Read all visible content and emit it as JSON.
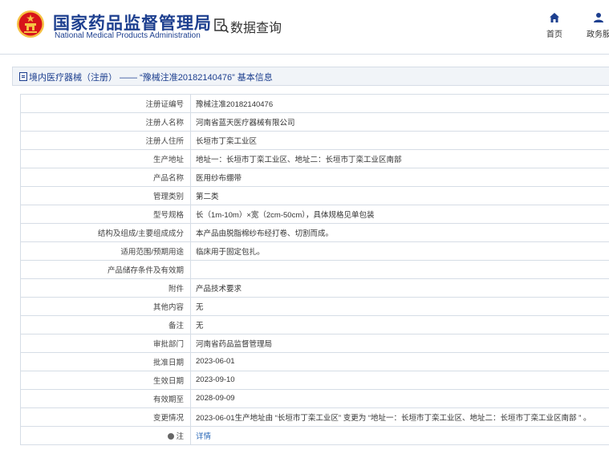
{
  "header": {
    "site_name_cn": "国家药品监督管理局",
    "site_name_en": "National Medical Products Administration",
    "page_title": "数据查询",
    "nav": [
      {
        "label": "首页",
        "icon": "home-icon"
      },
      {
        "label": "政务服",
        "icon": "user-icon"
      }
    ]
  },
  "breadcrumb": {
    "text": "境内医疗器械（注册） —— “豫械注准20182140476” 基本信息"
  },
  "record": [
    {
      "label": "注册证编号",
      "value": "豫械注准20182140476"
    },
    {
      "label": "注册人名称",
      "value": "河南省蓝天医疗器械有限公司"
    },
    {
      "label": "注册人住所",
      "value": "长垣市丁栾工业区"
    },
    {
      "label": "生产地址",
      "value": "地址一：长垣市丁栾工业区、地址二：长垣市丁栾工业区南部"
    },
    {
      "label": "产品名称",
      "value": "医用纱布绷带"
    },
    {
      "label": "管理类别",
      "value": "第二类"
    },
    {
      "label": "型号规格",
      "value": "长（1m-10m）×宽（2cm-50cm），具体规格见单包装"
    },
    {
      "label": "结构及组成/主要组成成分",
      "value": "本产品由脱脂棉纱布经打卷、切割而成。"
    },
    {
      "label": "适用范围/预期用途",
      "value": "临床用于固定包扎。"
    },
    {
      "label": "产品储存条件及有效期",
      "value": ""
    },
    {
      "label": "附件",
      "value": "产品技术要求"
    },
    {
      "label": "其他内容",
      "value": "无"
    },
    {
      "label": "备注",
      "value": "无"
    },
    {
      "label": "审批部门",
      "value": "河南省药品监督管理局"
    },
    {
      "label": "批准日期",
      "value": "2023-06-01"
    },
    {
      "label": "生效日期",
      "value": "2023-09-10"
    },
    {
      "label": "有效期至",
      "value": "2028-09-09"
    },
    {
      "label": "变更情况",
      "value": "2023-06-01生产地址由 “长垣市丁栾工业区” 变更为 “地址一：长垣市丁栾工业区、地址二：长垣市丁栾工业区南部 ” 。"
    },
    {
      "label": "注",
      "value": "详情",
      "label_icon": "info-icon"
    }
  ],
  "colors": {
    "brand": "#1d3f8f",
    "emblem_red": "#d7141a",
    "emblem_gold": "#f6c244",
    "border": "#d6dde6",
    "link": "#2a68b8"
  }
}
